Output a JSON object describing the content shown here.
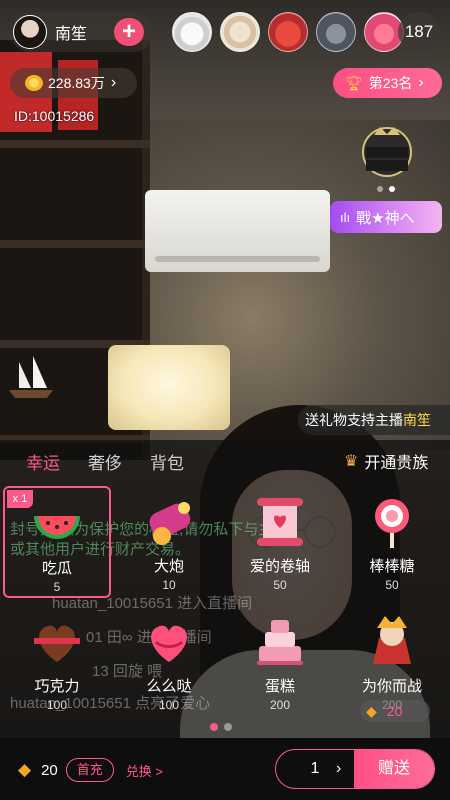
{
  "host": {
    "name": "南笙",
    "follow_symbol": "+",
    "coins": "228.83万",
    "id_text": "ID:10015286"
  },
  "viewers": {
    "count": "187"
  },
  "rank": {
    "label": "第23名"
  },
  "noble_banner": {
    "label": "戰★神へ"
  },
  "support_banner": {
    "prefix": "送礼物支持主播",
    "host": "南笙"
  },
  "tabs": [
    {
      "label": "幸运",
      "active": true
    },
    {
      "label": "奢侈",
      "active": false
    },
    {
      "label": "背包",
      "active": false
    }
  ],
  "open_noble": {
    "label": "开通贵族"
  },
  "gifts": [
    {
      "name": "吃瓜",
      "price": "5",
      "selected": true,
      "badge": "x 1"
    },
    {
      "name": "大炮",
      "price": "10"
    },
    {
      "name": "爱的卷轴",
      "price": "50"
    },
    {
      "name": "棒棒糖",
      "price": "50"
    },
    {
      "name": "巧克力",
      "price": "100"
    },
    {
      "name": "么么哒",
      "price": "100"
    },
    {
      "name": "蛋糕",
      "price": "200"
    },
    {
      "name": "为你而战",
      "price": "200"
    }
  ],
  "chat_overlay": {
    "line1": "封号处理,为保护您的权益,请勿私下与主播",
    "line2": "或其他用户进行财产交易。",
    "line3": "huatan_10015651 进入直播间",
    "line4": "01 田∞ 进入直播间",
    "line5": "13 回旋 喂",
    "line6": "huatan_10015651 点亮了爱心"
  },
  "gem_badge": {
    "value": "20"
  },
  "bottom": {
    "balance": "20",
    "recharge_label": "首充",
    "exchange_label": "兑换 >",
    "quantity": "1",
    "send_label": "赠送"
  },
  "colors": {
    "accent": "#ff5a8c",
    "gold": "#f6a623",
    "noble_purple": "#a24cf0"
  }
}
